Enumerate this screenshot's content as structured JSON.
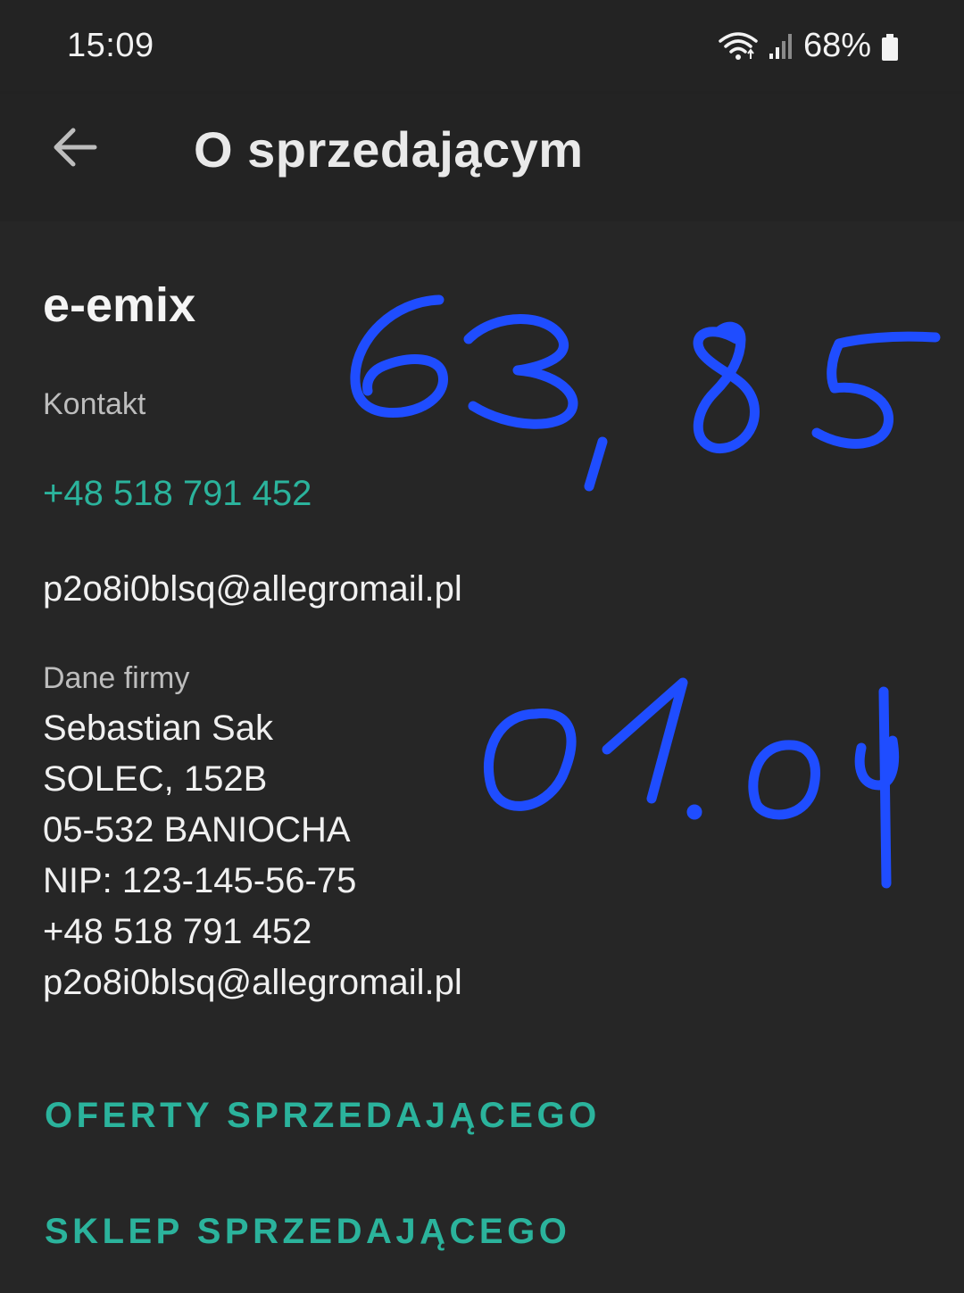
{
  "status_bar": {
    "time": "15:09",
    "battery": "68%"
  },
  "app_bar": {
    "title": "O sprzedającym"
  },
  "seller": {
    "name": "e-emix",
    "contact_label": "Kontakt",
    "phone": "+48 518 791 452",
    "email": "p2o8i0blsq@allegromail.pl",
    "company_label": "Dane firmy",
    "company_lines": [
      "Sebastian Sak",
      "SOLEC, 152B",
      "05-532 BANIOCHA",
      "NIP: 123-145-56-75",
      "+48 518 791 452",
      "p2o8i0blsq@allegromail.pl"
    ]
  },
  "actions": {
    "offers": "OFERTY SPRZEDAJĄCEGO",
    "shop": "SKLEP SPRZEDAJĄCEGO"
  },
  "annotations": {
    "note_amount": "63,85",
    "note_date": "01.04",
    "ink_color": "#1f4dff"
  },
  "colors": {
    "accent": "#2bb39c",
    "background": "#232323"
  }
}
